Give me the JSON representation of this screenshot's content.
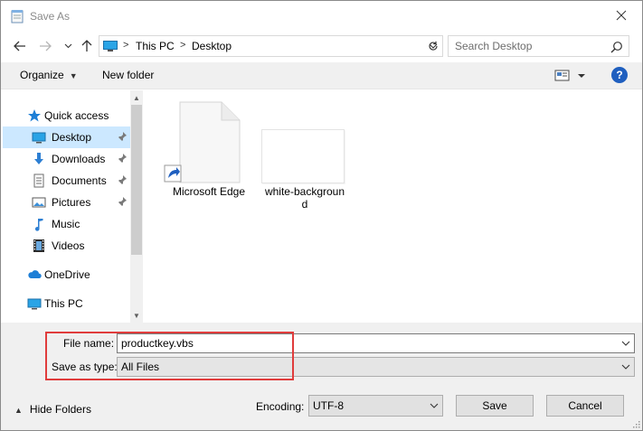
{
  "window": {
    "title": "Save As"
  },
  "nav": {
    "breadcrumbs": [
      "This PC",
      "Desktop"
    ],
    "search_placeholder": "Search Desktop"
  },
  "toolbar": {
    "organize_label": "Organize",
    "new_folder_label": "New folder"
  },
  "sidebar": {
    "items": [
      {
        "label": "Quick access",
        "icon": "star-icon"
      },
      {
        "label": "Desktop",
        "icon": "desktop-icon",
        "pinned": true,
        "selected": true
      },
      {
        "label": "Downloads",
        "icon": "download-arrow-icon",
        "pinned": true
      },
      {
        "label": "Documents",
        "icon": "document-icon",
        "pinned": true
      },
      {
        "label": "Pictures",
        "icon": "picture-icon",
        "pinned": true
      },
      {
        "label": "Music",
        "icon": "music-note-icon"
      },
      {
        "label": "Videos",
        "icon": "film-strip-icon"
      },
      {
        "label": "OneDrive",
        "icon": "cloud-icon"
      },
      {
        "label": "This PC",
        "icon": "monitor-icon"
      }
    ]
  },
  "files": [
    {
      "name": "Microsoft Edge",
      "icon": "shortcut-file-icon"
    },
    {
      "name": "white-background",
      "name_line1": "white-backgroun",
      "name_line2": "d",
      "icon": "image-thumbnail"
    }
  ],
  "form": {
    "file_name_label": "File name:",
    "file_name_value": "productkey.vbs",
    "save_as_type_label": "Save as type:",
    "save_as_type_value": "All Files",
    "encoding_label": "Encoding:",
    "encoding_value": "UTF-8"
  },
  "footer": {
    "hide_folders_label": "Hide Folders",
    "save_label": "Save",
    "cancel_label": "Cancel"
  },
  "colors": {
    "selection": "#cce8ff",
    "highlight_box": "#e03c3c",
    "help": "#1f5fbf"
  }
}
